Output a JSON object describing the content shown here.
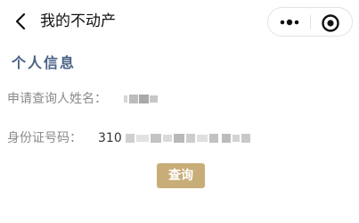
{
  "nav": {
    "title": "我的不动产",
    "back_icon": "chevron-left-icon",
    "more_icon": "more-dots-icon",
    "close_icon": "target-close-icon"
  },
  "section": {
    "title": "个人信息"
  },
  "form": {
    "name_label": "申请查询人姓名：",
    "name_value_redacted": true,
    "id_label": "身份证号码：",
    "id_visible_prefix": "310",
    "id_value_redacted": true
  },
  "actions": {
    "query_label": "查询"
  },
  "colors": {
    "section_title": "#4a6186",
    "button_bg": "#c9ad78",
    "label": "#8a8a8a"
  }
}
